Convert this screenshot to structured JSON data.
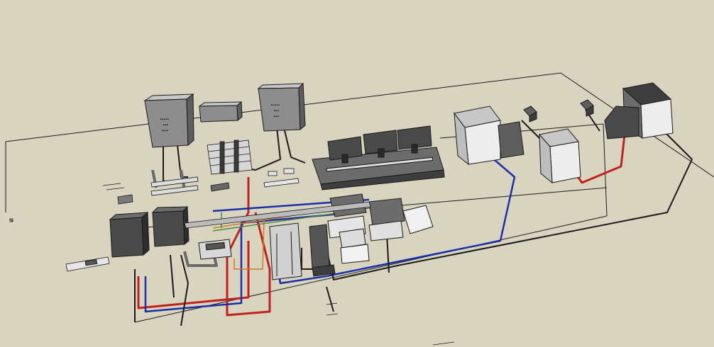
{
  "scene": {
    "background": "#d8d4c0",
    "colors": {
      "outline": "#1a1a1a",
      "box_front": "#8d8d8d",
      "box_top": "#c7c7c7",
      "box_side": "#5e5e5e",
      "light_front": "#ededed",
      "light_side": "#bdbdbd",
      "dark_front": "#3e3e3e",
      "dark_top": "#6c6c6c",
      "cable_red": "#c0231f",
      "cable_blue": "#1b2fa8",
      "cable_black": "#1a1a1a",
      "cable_orange": "#d07a25",
      "cable_green": "#4c8a3a",
      "cable_cyan": "#2aa8b4",
      "cable_gray": "#6a6a6a"
    },
    "icons": [
      "cabinet-icon",
      "monitor-icon",
      "rack-icon",
      "speaker-icon",
      "cable-icon"
    ]
  }
}
